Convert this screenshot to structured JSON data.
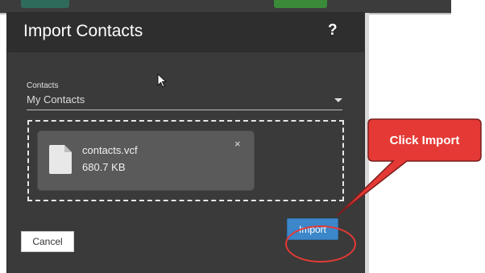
{
  "dialog": {
    "title": "Import Contacts",
    "help_label": "?"
  },
  "contacts_field": {
    "label": "Contacts",
    "value": "My Contacts"
  },
  "file": {
    "name": "contacts.vcf",
    "size": "680.7 KB",
    "remove_label": "×"
  },
  "buttons": {
    "cancel": "Cancel",
    "import": "Import"
  },
  "callout": {
    "text": "Click Import"
  },
  "colors": {
    "accent": "#3c87c9",
    "callout": "#e53935",
    "modal_bg": "#3a3a3a"
  }
}
